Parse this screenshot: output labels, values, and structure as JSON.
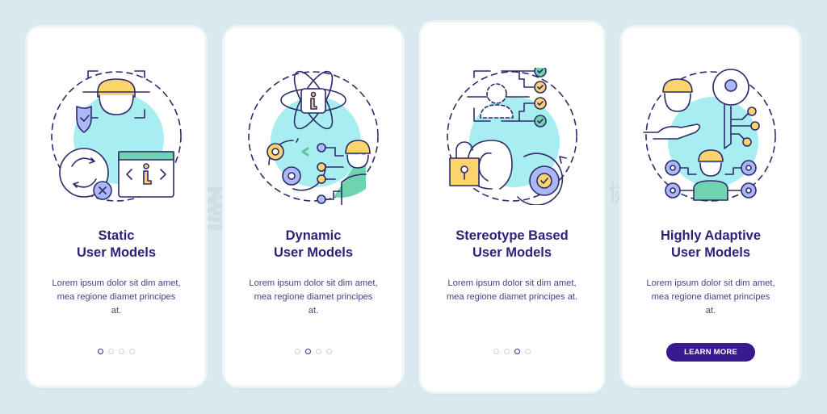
{
  "cards": [
    {
      "title_line1": "Static",
      "title_line2": "User Models",
      "description": "Lorem ipsum dolor sit dim amet, mea regione diamet principes at.",
      "active_page": 1,
      "icon": "face-scan-shield-sync-code-icon"
    },
    {
      "title_line1": "Dynamic",
      "title_line2": "User Models",
      "description": "Lorem ipsum dolor sit dim amet, mea regione diamet principes at.",
      "active_page": 2,
      "icon": "atom-gears-user-icon"
    },
    {
      "title_line1": "Stereotype Based",
      "title_line2": "User Models",
      "description": "Lorem ipsum dolor sit dim amet, mea regione diamet principes at.",
      "active_page": 3,
      "icon": "profile-checklist-ear-lock-gear-icon"
    },
    {
      "title_line1": "Highly Adaptive",
      "title_line2": "User Models",
      "description": "Lorem ipsum dolor sit dim amet, mea regione diamet principes at.",
      "icon": "hand-user-key-gears-icon",
      "button_label": "LEARN MORE"
    }
  ],
  "pagination": {
    "total": 4
  },
  "watermark": {
    "logo": "千图",
    "line1": "营销创意服务与协作平台",
    "line2": "商用请获取授权"
  },
  "colors": {
    "background": "#dae9ef",
    "title": "#2e1f7a",
    "button": "#3a1a8f",
    "accent_teal": "#9eeef0",
    "accent_yellow": "#fbd46d",
    "accent_blue": "#aab8f6",
    "accent_green": "#6fd3b0"
  }
}
